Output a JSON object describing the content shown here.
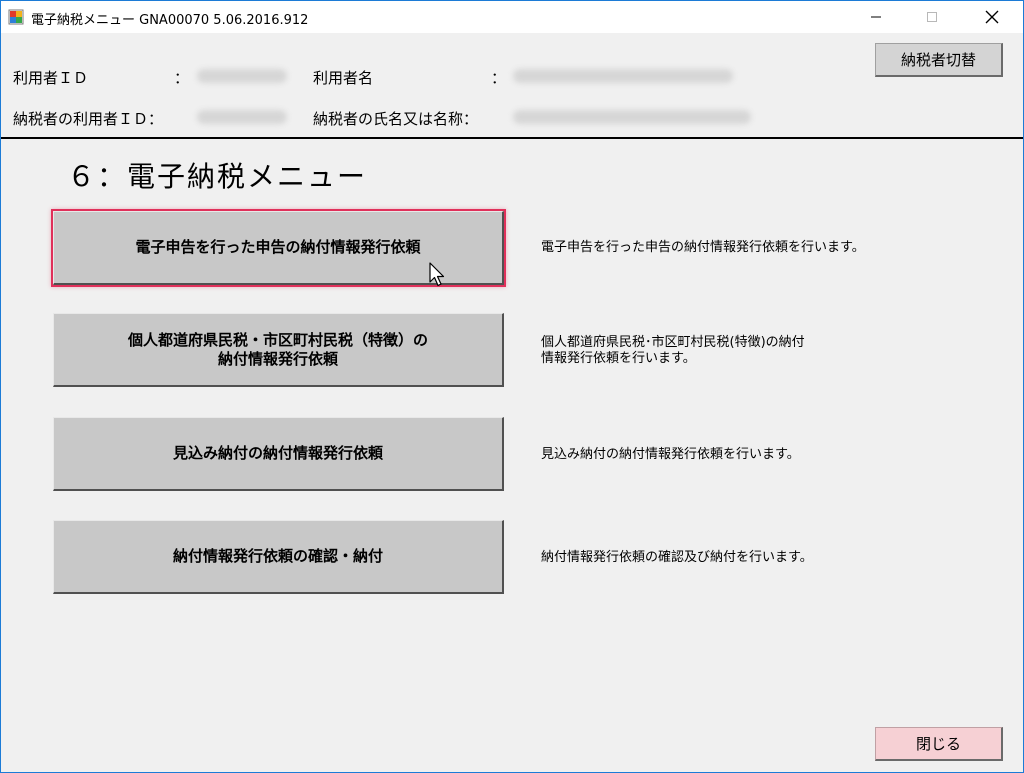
{
  "window": {
    "title": "電子納税メニュー GNA00070  5.06.2016.912"
  },
  "header": {
    "user_id_label": "利用者ＩＤ",
    "user_id_colon": "：",
    "user_name_label": "利用者名",
    "user_name_colon": "：",
    "taxpayer_id_label": "納税者の利用者ＩＤ：",
    "taxpayer_name_label": "納税者の氏名又は名称：",
    "switch_button": "納税者切替"
  },
  "menu": {
    "title": "６：電子納税メニュー",
    "items": [
      {
        "label": "電子申告を行った申告の納付情報発行依頼",
        "description": "電子申告を行った申告の納付情報発行依頼を行います。"
      },
      {
        "label_line1": "個人都道府県民税・市区町村民税（特徴）の",
        "label_line2": "納付情報発行依頼",
        "description_line1": "個人都道府県民税･市区町村民税(特徴)の納付",
        "description_line2": "情報発行依頼を行います。"
      },
      {
        "label": "見込み納付の納付情報発行依頼",
        "description": "見込み納付の納付情報発行依頼を行います。"
      },
      {
        "label": "納付情報発行依頼の確認・納付",
        "description": "納付情報発行依頼の確認及び納付を行います。"
      }
    ]
  },
  "footer": {
    "close_button": "閉じる"
  },
  "colors": {
    "accent_border": "#1c7bd6",
    "selection_highlight": "#e0305a",
    "close_button_bg": "#f6d0d4"
  }
}
